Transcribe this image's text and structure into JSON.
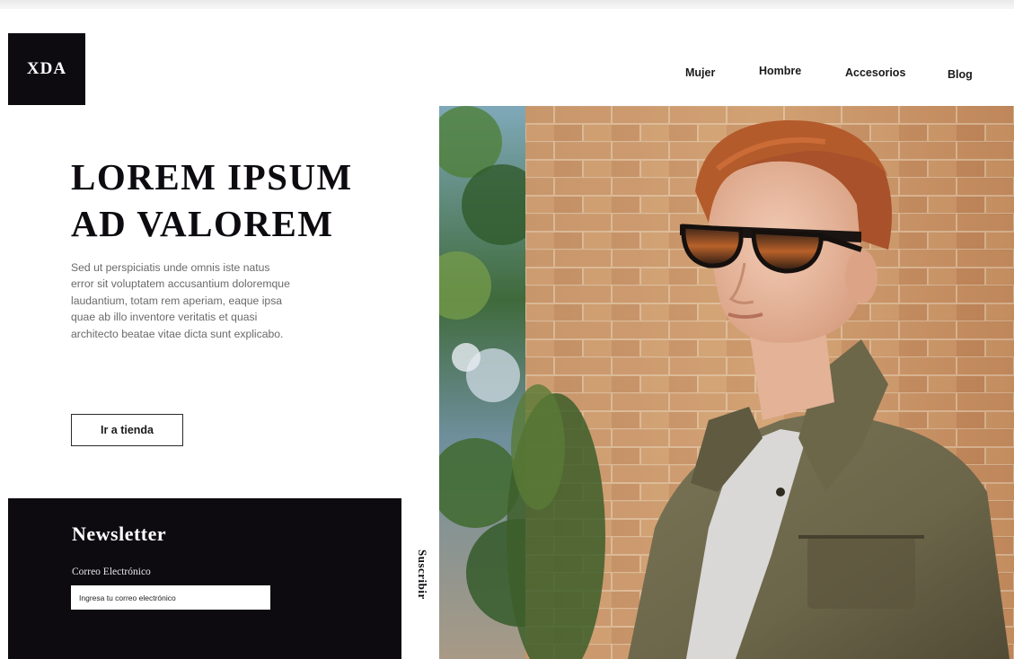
{
  "brand": {
    "logo_text": "XDA",
    "logo_bg": "#0d0b10",
    "accent": "#0d0b10"
  },
  "nav": {
    "items": [
      {
        "label": "Mujer"
      },
      {
        "label": "Hombre"
      },
      {
        "label": "Accesorios"
      },
      {
        "label": "Blog"
      }
    ]
  },
  "hero": {
    "title_line_1": "LOREM IPSUM",
    "title_line_2": "AD VALOREM",
    "body": "Sed ut perspiciatis unde omnis iste natus error sit voluptatem accusantium doloremque laudantium, totam rem aperiam, eaque ipsa quae ab illo inventore veritatis et quasi architecto beatae vitae dicta sunt explicabo.",
    "button_label": "Ir a tienda",
    "image_icon": "hero-model-photo"
  },
  "newsletter": {
    "title": "Newsletter",
    "email_label": "Correo Electrónico",
    "email_placeholder": "Ingresa tu correo electrónico",
    "email_value": "",
    "subscribe_label": "Suscribir"
  }
}
